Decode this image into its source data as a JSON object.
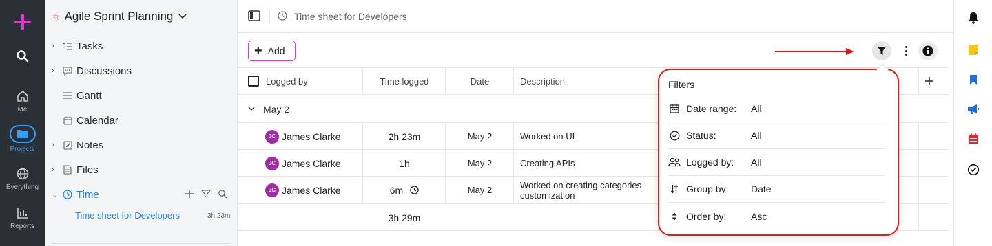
{
  "rail": {
    "items": [
      {
        "label": "Me"
      },
      {
        "label": "Projects"
      },
      {
        "label": "Everything"
      },
      {
        "label": "Reports"
      }
    ]
  },
  "sidebar": {
    "project_title": "Agile Sprint Planning",
    "items": [
      {
        "label": "Tasks"
      },
      {
        "label": "Discussions"
      },
      {
        "label": "Gantt"
      },
      {
        "label": "Calendar"
      },
      {
        "label": "Notes"
      },
      {
        "label": "Files"
      },
      {
        "label": "Time"
      }
    ],
    "sub_item": {
      "label": "Time sheet for Developers",
      "count": "3h 23m"
    }
  },
  "header": {
    "title": "Time sheet for Developers"
  },
  "toolbar": {
    "add_label": "Add"
  },
  "table": {
    "columns": [
      "Logged by",
      "Time logged",
      "Date",
      "Description"
    ],
    "group": "May 2",
    "rows": [
      {
        "initials": "JC",
        "name": "James Clarke",
        "time": "2h 23m",
        "date": "May 2",
        "description": "Worked on UI"
      },
      {
        "initials": "JC",
        "name": "James Clarke",
        "time": "1h",
        "date": "May 2",
        "description": "Creating APIs"
      },
      {
        "initials": "JC",
        "name": "James Clarke",
        "time": "6m",
        "date": "May 2",
        "description": "Worked on creating categories customization"
      }
    ],
    "total": "3h 29m"
  },
  "filters": {
    "title": "Filters",
    "rows": [
      {
        "label": "Date range:",
        "value": "All",
        "icon": "calendar-icon"
      },
      {
        "label": "Status:",
        "value": "All",
        "icon": "check-circle-icon"
      },
      {
        "label": "Logged by:",
        "value": "All",
        "icon": "users-icon"
      },
      {
        "label": "Group by:",
        "value": "Date",
        "icon": "sort-arrows-icon"
      },
      {
        "label": "Order by:",
        "value": "Asc",
        "icon": "order-icon"
      }
    ]
  },
  "colors": {
    "accent": "#1a8cff",
    "brand": "#e23ad3",
    "highlight": "#e01b1b"
  }
}
